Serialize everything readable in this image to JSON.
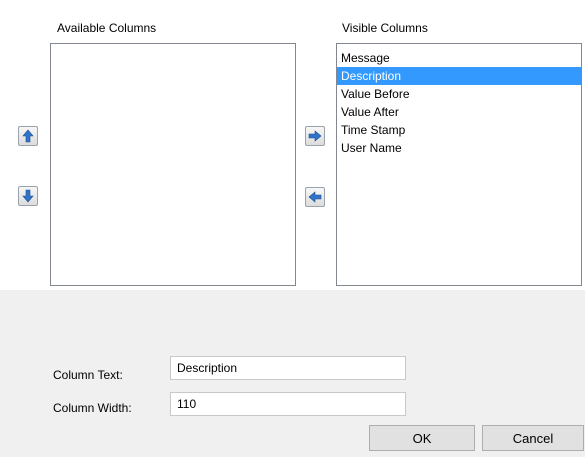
{
  "available": {
    "label": "Available Columns",
    "items": []
  },
  "visible": {
    "label": "Visible Columns",
    "items": [
      "Message",
      "Description",
      "Value Before",
      "Value After",
      "Time Stamp",
      "User Name"
    ],
    "selected_index": 1
  },
  "icons": {
    "move_up": "arrow-up-icon",
    "move_down": "arrow-down-icon",
    "move_right": "arrow-right-icon",
    "move_left": "arrow-left-icon"
  },
  "form": {
    "column_text_label": "Column Text:",
    "column_text_value": "Description",
    "column_width_label": "Column Width:",
    "column_width_value": "110"
  },
  "buttons": {
    "ok": "OK",
    "cancel": "Cancel"
  },
  "colors": {
    "selection": "#3399ff",
    "panel": "#f0f0f0",
    "arrow": "#2f74c9"
  }
}
